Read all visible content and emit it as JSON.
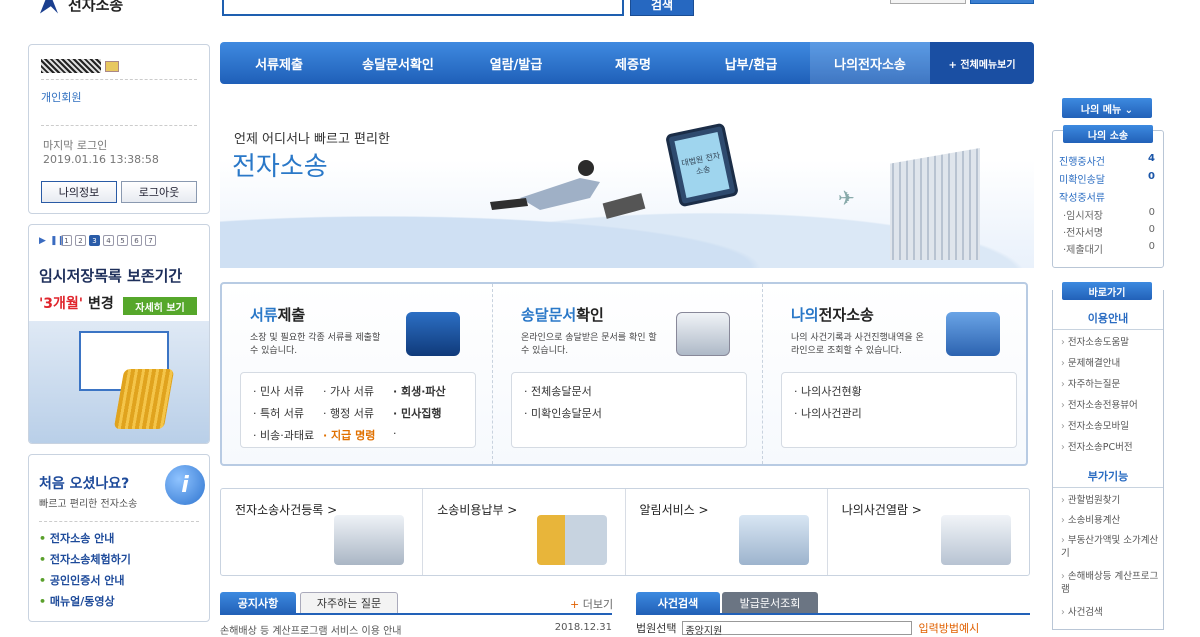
{
  "header": {
    "logo_text": "전자소송",
    "search_button": "검색"
  },
  "login": {
    "member_type": "개인회원",
    "last_login_label": "마지막 로그인",
    "last_login_time": "2019.01.16 13:38:58",
    "my_info": "나의정보",
    "logout": "로그아웃"
  },
  "banner": {
    "pages": [
      "1",
      "2",
      "3",
      "4",
      "5",
      "6",
      "7"
    ],
    "active_page": "3",
    "title": "임시저장목록 보존기간",
    "highlight": "'3개월'",
    "changed": "변경",
    "more": "자세히 보기"
  },
  "first_visit": {
    "title": "처음 오셨나요?",
    "subtitle": "빠르고 편리한 전자소송",
    "icon": "i",
    "links": [
      "전자소송 안내",
      "전자소송체험하기",
      "공인인증서 안내",
      "매뉴얼/동영상"
    ]
  },
  "nav": {
    "items": [
      "서류제출",
      "송달문서확인",
      "열람/발급",
      "제증명",
      "납부/환급",
      "나의전자소송"
    ],
    "all_menu": "+ 전체메뉴보기"
  },
  "hero": {
    "line1": "언제 어디서나 빠르고 편리한",
    "line2": "전자소송",
    "monitor_text": "대법원 전자소송"
  },
  "services": [
    {
      "title_hl": "서류",
      "title_rest": "제출",
      "desc": "소장 및 필요한 각종 서류를 제출할 수 있습니다."
    },
    {
      "title_hl": "송달문서",
      "title_rest": "확인",
      "desc": "온라인으로 송달받은 문서를 확인 할 수 있습니다.",
      "list": [
        "전체송달문서",
        "미확인송달문서"
      ]
    },
    {
      "title_hl": "나의",
      "title_rest": "전자소송",
      "desc": "나의 사건기록과 사건진행내역을 온라인으로 조회할 수 있습니다.",
      "list": [
        "나의사건현황",
        "나의사건관리"
      ]
    }
  ],
  "doc_list": {
    "r1": [
      "민사 서류",
      "가사 서류",
      "회생·파산"
    ],
    "r2": [
      "특허 서류",
      "행정 서류",
      "민사집행"
    ],
    "r3": [
      "비송·과태료",
      "지급 명령"
    ]
  },
  "quick": [
    "전자소송사건등록 >",
    "소송비용납부 >",
    "알림서비스 >",
    "나의사건열람 >"
  ],
  "bottom": {
    "tab_notice": "공지사항",
    "tab_faq": "자주하는 질문",
    "more": "더보기",
    "notice_title": "손해배상 등 계산프로그램 서비스 이용 안내",
    "notice_date": "2018.12.31",
    "tab_case": "사건검색",
    "tab_doc": "발급문서조회",
    "court_label": "법원선택",
    "court_value": "종앙지원",
    "court_guide": "입력방법예시"
  },
  "my_menu": "나의 메뉴 ⌄",
  "my_case": {
    "head": "나의 소송",
    "rows": [
      {
        "label": "진행중사건",
        "value": "4"
      },
      {
        "label": "미확인송달",
        "value": "0"
      },
      {
        "label": "작성중서류",
        "value": ""
      }
    ],
    "sub": [
      {
        "label": "·임시저장",
        "value": "0"
      },
      {
        "label": "·전자서명",
        "value": "0"
      },
      {
        "label": "·제출대기",
        "value": "0"
      }
    ]
  },
  "shortcut": {
    "head": "바로가기",
    "group1": "이용안내",
    "items1": [
      "전자소송도움말",
      "문제해결안내",
      "자주하는질문",
      "전자소송전용뷰어",
      "전자소송모바일",
      "전자소송PC버전"
    ],
    "group2": "부가기능",
    "items2": [
      "관할법원찾기",
      "소송비용계산",
      "부동산가액및 소가계산기",
      "손해배상등 계산프로그램",
      "사건검색"
    ]
  }
}
